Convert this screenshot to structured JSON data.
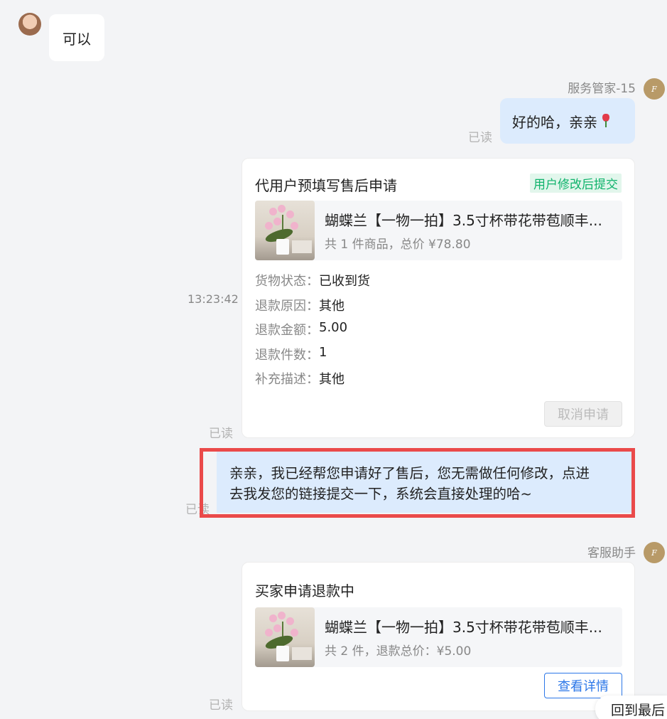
{
  "messages": {
    "m1": {
      "text": "可以"
    },
    "m2": {
      "sender": "服务管家-15",
      "text": "好的哈，亲亲",
      "read": "已读"
    },
    "card1": {
      "time": "13:23:42",
      "title": "代用户预填写售后申请",
      "badge": "用户修改后提交",
      "product_name": "蝴蝶兰【一物一拍】3.5寸杯带花带苞顺丰...",
      "product_sub": "共 1 件商品，总价 ¥78.80",
      "fields": [
        {
          "key": "货物状态：",
          "value": "已收到货"
        },
        {
          "key": "退款原因：",
          "value": "其他"
        },
        {
          "key": "退款金额：",
          "value": "5.00"
        },
        {
          "key": "退款件数：",
          "value": "1"
        },
        {
          "key": "补充描述：",
          "value": "其他"
        }
      ],
      "button": "取消申请",
      "read": "已读"
    },
    "m3": {
      "line1": "亲亲，我已经帮您申请好了售后，您无需做任何修改，点进",
      "line2": "去我发您的链接提交一下，系统会直接处理的哈~",
      "read": "已读"
    },
    "card2": {
      "sender": "客服助手",
      "title": "买家申请退款中",
      "product_name": "蝴蝶兰【一物一拍】3.5寸杯带花带苞顺丰...",
      "product_sub": "共 2 件，退款总价：¥5.00",
      "button": "查看详情",
      "read": "已读"
    }
  },
  "avatar_letter": "F",
  "back_to_latest": "回到最后",
  "colors": {
    "bubble_blue": "#dcebfd",
    "highlight": "#ea4a4a",
    "badge_green": "#10b36c",
    "link_blue": "#2c77e8"
  },
  "icons": [
    "user-avatar",
    "shop-avatar",
    "tulip-emoji"
  ]
}
